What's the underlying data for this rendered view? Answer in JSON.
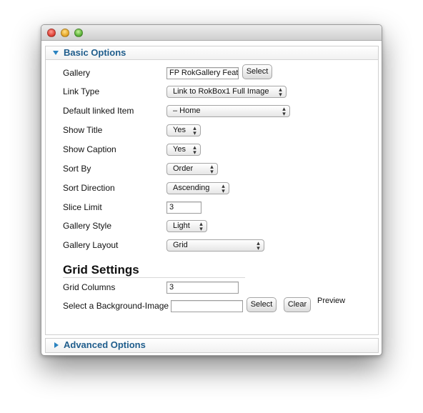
{
  "window": {
    "controls": [
      "close-icon",
      "minimize-icon",
      "zoom-icon"
    ]
  },
  "basic_options": {
    "title": "Basic Options",
    "fields": {
      "gallery": {
        "label": "Gallery",
        "value": "FP RokGallery Featu",
        "button": "Select"
      },
      "link_type": {
        "label": "Link Type",
        "value": "Link to RokBox1 Full Image"
      },
      "default_linked_item": {
        "label": "Default linked Item",
        "value": "– Home"
      },
      "show_title": {
        "label": "Show Title",
        "value": "Yes"
      },
      "show_caption": {
        "label": "Show Caption",
        "value": "Yes"
      },
      "sort_by": {
        "label": "Sort By",
        "value": "Order"
      },
      "sort_direction": {
        "label": "Sort Direction",
        "value": "Ascending"
      },
      "slice_limit": {
        "label": "Slice Limit",
        "value": "3"
      },
      "gallery_style": {
        "label": "Gallery Style",
        "value": "Light"
      },
      "gallery_layout": {
        "label": "Gallery Layout",
        "value": "Grid"
      }
    },
    "grid_settings": {
      "title": "Grid Settings",
      "grid_columns": {
        "label": "Grid Columns",
        "value": "3"
      },
      "background_image": {
        "label": "Select a Background-Image",
        "value": "",
        "select_button": "Select",
        "clear_button": "Clear",
        "preview_label": "Preview"
      }
    }
  },
  "advanced_options": {
    "title": "Advanced Options"
  },
  "colors": {
    "accent": "#1f5d8c",
    "arrow": "#2a83c0"
  }
}
